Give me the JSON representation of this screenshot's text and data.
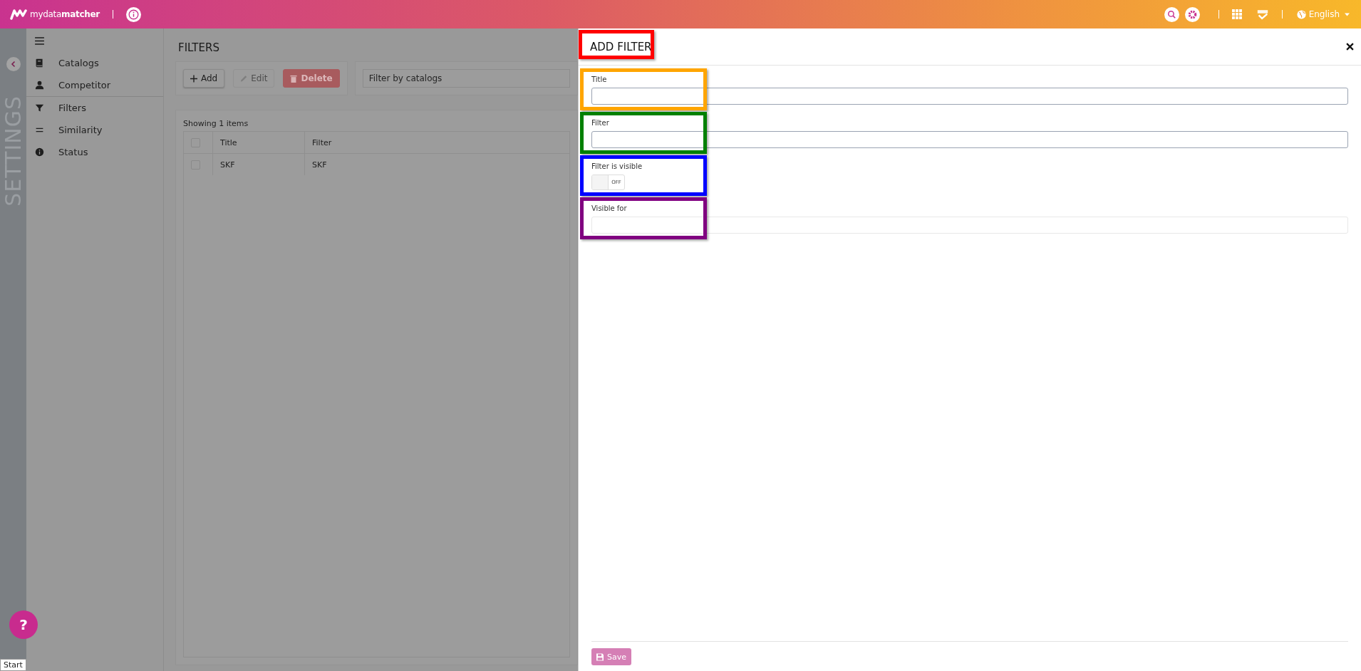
{
  "topbar": {
    "logo_text": "mydata**matcher**",
    "language": "English"
  },
  "settings_strip": {
    "label": "SETTINGS"
  },
  "sidebar": {
    "items": [
      {
        "label": "Catalogs",
        "selected": false
      },
      {
        "label": "Competitor",
        "selected": false
      },
      {
        "label": "Filters",
        "selected": true
      },
      {
        "label": "Similarity",
        "selected": false
      },
      {
        "label": "Status",
        "selected": false
      }
    ]
  },
  "main": {
    "title": "FILTERS",
    "buttons": [
      {
        "label": "Add",
        "kind": "add",
        "disabled": false
      },
      {
        "label": "Edit",
        "kind": "edit",
        "disabled": true
      },
      {
        "label": "Delete",
        "kind": "delete",
        "disabled": false
      }
    ],
    "catalog_filter": {
      "placeholder": "Filter by catalogs"
    },
    "table": {
      "summary": "Showing 1 items",
      "header_checked": false,
      "columns": [
        "Title",
        "Filter"
      ],
      "rows": [
        {
          "checked": false,
          "cells": [
            "SKF",
            "SKF"
          ]
        }
      ]
    }
  },
  "panel": {
    "title": "ADD FILTER",
    "fields": [
      {
        "kind": "text",
        "label": "Title"
      },
      {
        "kind": "text",
        "label": "Filter"
      },
      {
        "kind": "toggle",
        "label": "Filter is visible",
        "on": false,
        "state_text": "OFF"
      },
      {
        "kind": "select",
        "label": "Visible for"
      }
    ],
    "save": {
      "label": "Save",
      "disabled": true
    }
  },
  "highlights": [
    {
      "color": "#ff0000"
    },
    {
      "color": "#ffa500"
    },
    {
      "color": "#008000"
    },
    {
      "color": "#0000ff"
    },
    {
      "color": "#800080"
    }
  ],
  "help_button": {
    "label": "?"
  },
  "tooltip": "Start"
}
